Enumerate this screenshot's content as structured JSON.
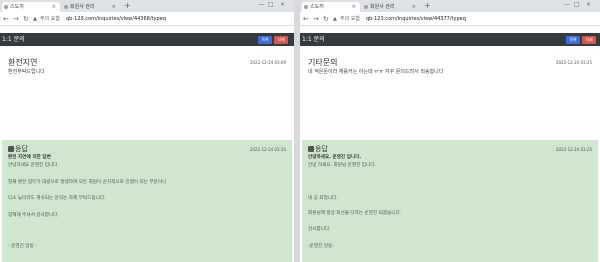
{
  "left": {
    "tab_title": "스도끼",
    "tab2_title": "회원사 관리",
    "security_label": "주의 요함",
    "url": "qb-123.com/inquiries/view/44368/typeq",
    "app_title": "1:1 문의",
    "edit_label": "목록",
    "delete_label": "삭제",
    "question": {
      "title": "환전지연",
      "date": "2022-12-24 03:09",
      "body": "환전부탁드립니다"
    },
    "answer": {
      "heading": "응답",
      "date": "2022-12-24 03:30",
      "lines": [
        "환전 지연에 의한 답변",
        "안녕하세요 운영진 입니다.",
        "현재 환전 업무가 대량으로 발생하여 모든 회원이 순차적으로 진행이 되는 부분이니",
        "다소 늦더라도 계속되는 문의는 자제 부탁드립니다.",
        "양해해 주셔서 감사합니다.",
        "- 운영진 일동 -"
      ]
    }
  },
  "right": {
    "tab_title": "스도끼",
    "tab2_title": "회원사 관리",
    "security_label": "주의 요함",
    "url": "qb-123.com/inquiries/view/44377/typeq",
    "app_title": "1:1 문의",
    "edit_label": "목록",
    "delete_label": "삭제",
    "question": {
      "title": "기타문의",
      "date": "2022-12-24 03:25",
      "body": "네 적은돈이라 재롤커는 아는데 ㅠㅠ 자꾸 문의드려서 죄송합니다"
    },
    "answer": {
      "heading": "응답",
      "date": "2022-12-24 03:25",
      "lines": [
        "안녕하세요, 운영진 입니다.",
        "안녕 하세요. 회원님 운영진 입니다.",
        "네 공 되었니다.",
        "회원님께 항상 최선을 다하는 운영진 되겠습니다.",
        "감사합니다.",
        "-운영진 일동-"
      ]
    }
  }
}
